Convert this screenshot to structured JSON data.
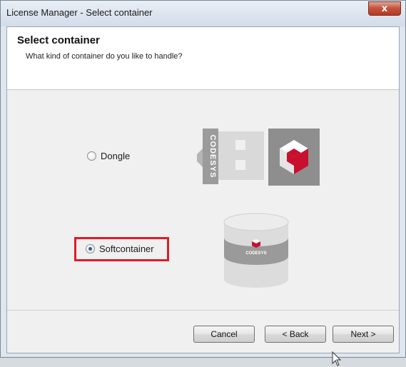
{
  "window": {
    "title": "License Manager - Select container",
    "close_label": "x"
  },
  "header": {
    "title": "Select container",
    "subtitle": "What kind of container do you like to handle?"
  },
  "options": [
    {
      "label": "Dongle",
      "selected": false,
      "icon": "codesys-dongle-icon"
    },
    {
      "label": "Softcontainer",
      "selected": true,
      "icon": "codesys-softcontainer-icon"
    }
  ],
  "dongle_brand_text": "CODESYS",
  "softcontainer_brand_text": "CODESYS",
  "buttons": {
    "cancel": "Cancel",
    "back": "< Back",
    "next": "Next >"
  },
  "colors": {
    "highlight": "#e01b24",
    "brand_red": "#c8102e"
  }
}
